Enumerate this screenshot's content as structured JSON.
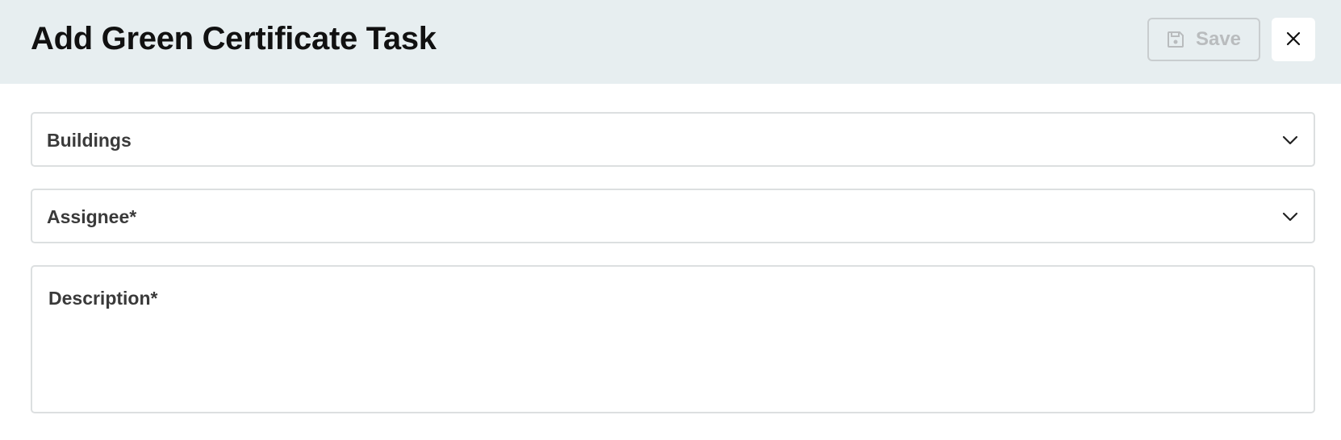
{
  "header": {
    "title": "Add Green Certificate Task",
    "save_label": "Save",
    "save_icon": "floppy-disk-icon",
    "close_icon": "close-icon"
  },
  "form": {
    "buildings": {
      "label": "Buildings",
      "icon": "chevron-down-icon"
    },
    "assignee": {
      "label": "Assignee*",
      "icon": "chevron-down-icon"
    },
    "description": {
      "label": "Description*"
    }
  },
  "colors": {
    "header_bg": "#e7eef0",
    "border": "#dcdfe0",
    "disabled_text": "#b9bcbe"
  }
}
